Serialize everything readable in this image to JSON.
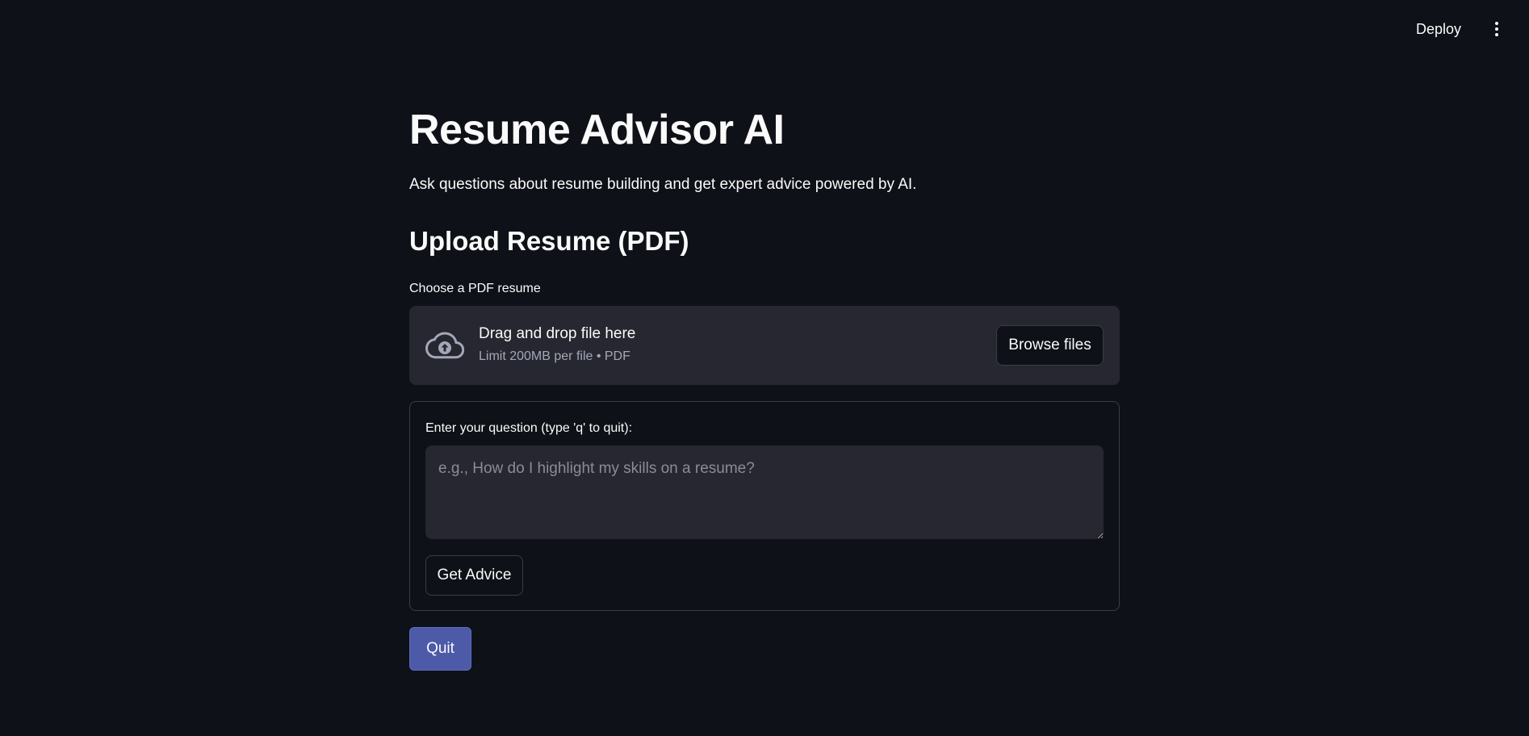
{
  "header": {
    "deploy_label": "Deploy",
    "menu_icon": "kebab-menu-icon"
  },
  "main": {
    "title": "Resume Advisor AI",
    "subtitle": "Ask questions about resume building and get expert advice powered by AI.",
    "upload_section_title": "Upload Resume (PDF)",
    "uploader": {
      "label": "Choose a PDF resume",
      "dropzone_text": "Drag and drop file here",
      "dropzone_limit": "Limit 200MB per file • PDF",
      "browse_label": "Browse files",
      "icon": "cloud-upload-icon"
    },
    "question_form": {
      "label": "Enter your question (type 'q' to quit):",
      "placeholder": "e.g., How do I highlight my skills on a resume?",
      "value": "",
      "submit_label": "Get Advice"
    },
    "quit_label": "Quit"
  },
  "colors": {
    "background": "#0e1117",
    "surface": "#262730",
    "text": "#fafafa",
    "muted": "#a3a8b8",
    "border": "#3a3d47",
    "primary": "#4c5aa8"
  }
}
